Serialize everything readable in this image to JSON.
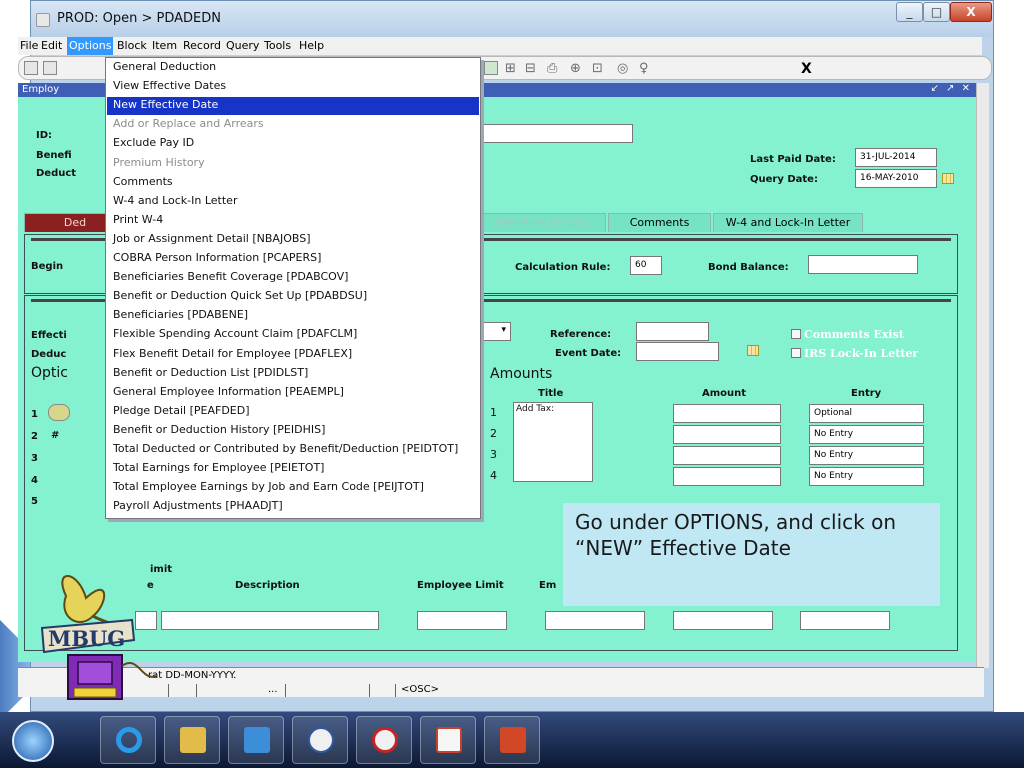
{
  "window": {
    "title": "PROD: Open > PDADEDN",
    "min_label": "_",
    "max_label": "□",
    "close_label": "X"
  },
  "menubar": [
    "File",
    "Edit",
    "Options",
    "Block",
    "Item",
    "Record",
    "Query",
    "Tools",
    "Help"
  ],
  "menubar_active": "Options",
  "toolbar": {
    "exit_label": "X"
  },
  "form": {
    "title": "Employ",
    "labels": {
      "id": "ID:",
      "benefit": "Benefi",
      "deduction": "Deduct",
      "last_paid": "Last Paid Date:",
      "query_date": "Query Date:",
      "begin": "Begin",
      "calc_rule": "Calculation Rule:",
      "bond_balance": "Bond Balance:",
      "effective": "Effecti",
      "deduc2": "Deduc",
      "options_heading": "Optic",
      "reference": "Reference:",
      "event_date": "Event Date:"
    },
    "values": {
      "last_paid": "31-JUL-2014",
      "query_date": "16-MAY-2010",
      "calc_rule": "60"
    },
    "tabs": [
      "Ded",
      "Premium History",
      "Comments",
      "W-4 and Lock-In Letter"
    ],
    "checkboxes": [
      "Comments Exist",
      "IRS Lock-In Letter"
    ],
    "amounts": {
      "heading": "Amounts",
      "col_title": "Title",
      "col_amount": "Amount",
      "col_entry": "Entry",
      "rows": [
        {
          "n": "1",
          "title": "Add Tax:",
          "entry": "Optional"
        },
        {
          "n": "2",
          "title": "",
          "entry": "No Entry"
        },
        {
          "n": "3",
          "title": "",
          "entry": "No Entry"
        },
        {
          "n": "4",
          "title": "",
          "entry": "No Entry"
        }
      ]
    },
    "left_rows": [
      "1",
      "2",
      "3",
      "4",
      "5"
    ],
    "row2_mark": "#",
    "limit": {
      "heading": "imit",
      "col_e": "e",
      "col_description": "Description",
      "col_employee_limit": "Employee Limit",
      "col_em": "Em"
    }
  },
  "options_menu": [
    {
      "label": "General Deduction",
      "state": "normal"
    },
    {
      "label": "View Effective Dates",
      "state": "normal"
    },
    {
      "label": "New Effective Date",
      "state": "highlight"
    },
    {
      "label": "Add or Replace and Arrears",
      "state": "disabled"
    },
    {
      "label": "Exclude Pay ID",
      "state": "normal"
    },
    {
      "label": "Premium History",
      "state": "disabled"
    },
    {
      "label": "Comments",
      "state": "normal"
    },
    {
      "label": "W-4 and Lock-In Letter",
      "state": "normal"
    },
    {
      "label": "Print W-4",
      "state": "normal"
    },
    {
      "label": "Job or Assignment Detail [NBAJOBS]",
      "state": "normal"
    },
    {
      "label": "COBRA Person Information [PCAPERS]",
      "state": "normal"
    },
    {
      "label": "Beneficiaries Benefit Coverage [PDABCOV]",
      "state": "normal"
    },
    {
      "label": "Benefit or Deduction Quick Set Up [PDABDSU]",
      "state": "normal"
    },
    {
      "label": "Beneficiaries [PDABENE]",
      "state": "normal"
    },
    {
      "label": "Flexible Spending Account Claim [PDAFCLM]",
      "state": "normal"
    },
    {
      "label": "Flex Benefit Detail for Employee [PDAFLEX]",
      "state": "normal"
    },
    {
      "label": "Benefit or Deduction List [PDIDLST]",
      "state": "normal"
    },
    {
      "label": "General Employee Information [PEAEMPL]",
      "state": "normal"
    },
    {
      "label": "Pledge Detail [PEAFDED]",
      "state": "normal"
    },
    {
      "label": "Benefit or Deduction History [PEIDHIS]",
      "state": "normal"
    },
    {
      "label": "Total Deducted or Contributed by Benefit/Deduction [PEIDTOT]",
      "state": "normal"
    },
    {
      "label": "Total Earnings for Employee [PEIETOT]",
      "state": "normal"
    },
    {
      "label": "Total Employee Earnings by Job and Earn Code [PEIJTOT]",
      "state": "normal"
    },
    {
      "label": "Payroll Adjustments [PHAADJT]",
      "state": "normal"
    }
  ],
  "callout": "Go under OPTIONS, and click on “NEW” Effective Date",
  "status": {
    "message": "rat DD-MON-YYYY.",
    "ellipsis": "...",
    "osc": "<OSC>"
  },
  "logo": "MBUG",
  "colors": {
    "form_bg": "#84f1d0",
    "menu_highlight": "#1734c8",
    "callout_bg": "#bfe8f4",
    "title_blue": "#3f5fb5"
  },
  "taskbar": [
    "start-orb-icon",
    "internet-explorer-icon",
    "file-explorer-icon",
    "outlook-icon",
    "remote-desktop-icon",
    "norton-icon",
    "java-icon",
    "powerpoint-icon"
  ]
}
